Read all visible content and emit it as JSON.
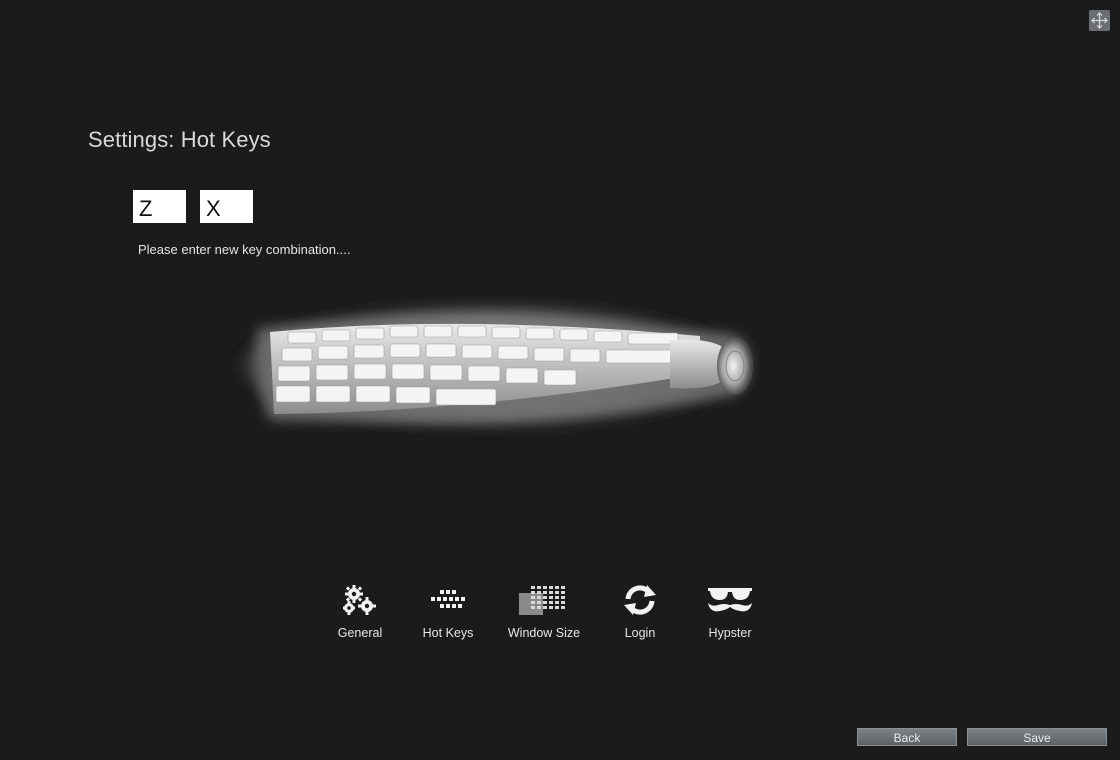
{
  "window": {
    "move_handle_icon": "move-arrows-icon"
  },
  "header": {
    "title": "Settings: Hot Keys"
  },
  "hotkeys": {
    "key1": "Z",
    "key2": "X",
    "hint": "Please enter new key combination...."
  },
  "nav": {
    "items": [
      {
        "label": "General",
        "icon": "gears-icon"
      },
      {
        "label": "Hot Keys",
        "icon": "keys-icon"
      },
      {
        "label": "Window Size",
        "icon": "keyboard-grid-icon"
      },
      {
        "label": "Login",
        "icon": "refresh-icon"
      },
      {
        "label": "Hypster",
        "icon": "sunglasses-mustache-icon"
      }
    ]
  },
  "footer": {
    "back_label": "Back",
    "save_label": "Save"
  },
  "colors": {
    "background": "#1b1b1b",
    "button": "#6a7074",
    "text": "#e6e6e6"
  }
}
